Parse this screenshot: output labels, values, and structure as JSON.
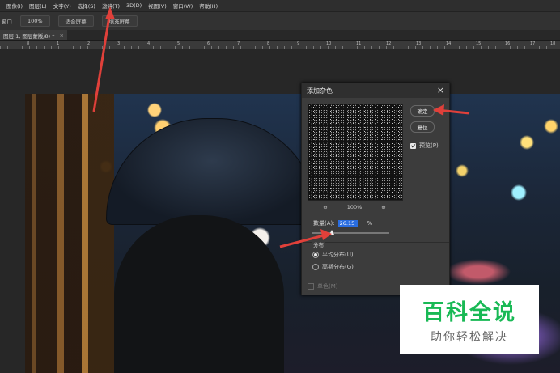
{
  "menubar": {
    "items": [
      "图像(I)",
      "图层(L)",
      "文字(Y)",
      "选择(S)",
      "滤镜(T)",
      "3D(D)",
      "视图(V)",
      "窗口(W)",
      "帮助(H)"
    ]
  },
  "optionsbar": {
    "label": "窗口",
    "buttons": [
      "100%",
      "适合屏幕",
      "填充屏幕"
    ]
  },
  "tab": {
    "label": "图层 1, 图层蒙版/8) *",
    "close": "×"
  },
  "ruler": {
    "labels": [
      "8",
      "1",
      "2",
      "3",
      "4",
      "5",
      "6",
      "7",
      "8",
      "9",
      "10",
      "11",
      "12",
      "13",
      "14",
      "15",
      "16",
      "17",
      "18"
    ]
  },
  "dialog": {
    "title": "添加杂色",
    "close": "×",
    "zoom_out": "⊖",
    "zoom_level": "100%",
    "zoom_in": "⊕",
    "ok_label": "确定",
    "reset_label": "复位",
    "preview_label": "预览(P)",
    "preview_checked": true,
    "amount_label": "数量(A):",
    "amount_value": "26.15",
    "amount_unit": "%",
    "amount_percent": 26.15,
    "distribution_label": "分布",
    "uniform_label": "平均分布(U)",
    "gaussian_label": "高斯分布(G)",
    "selected_distribution": "uniform",
    "mono_label": "单色(M)"
  },
  "watermark": {
    "title": "百科全说",
    "subtitle": "助你轻松解决"
  },
  "colors": {
    "arrow": "#e0403a",
    "accent_green": "#19b955",
    "selection_blue": "#2a6de0"
  }
}
